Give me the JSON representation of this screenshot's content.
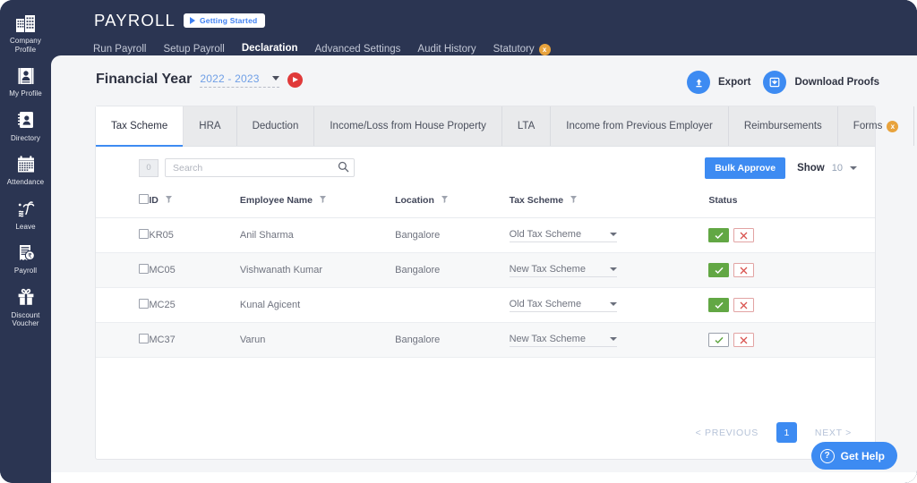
{
  "sidebar": {
    "items": [
      {
        "label": "Company Profile",
        "icon": "building-icon"
      },
      {
        "label": "My Profile",
        "icon": "id-card-icon"
      },
      {
        "label": "Directory",
        "icon": "address-book-icon"
      },
      {
        "label": "Attendance",
        "icon": "calendar-icon"
      },
      {
        "label": "Leave",
        "icon": "palm-tree-icon"
      },
      {
        "label": "Payroll",
        "icon": "payslip-rupee-icon"
      },
      {
        "label": "Discount Voucher",
        "icon": "gift-icon"
      }
    ]
  },
  "header": {
    "brand": "PAYROLL",
    "getting_started": "Getting Started",
    "nav": [
      {
        "label": "Run Payroll",
        "active": false,
        "badge": ""
      },
      {
        "label": "Setup Payroll",
        "active": false,
        "badge": ""
      },
      {
        "label": "Declaration",
        "active": true,
        "badge": ""
      },
      {
        "label": "Advanced Settings",
        "active": false,
        "badge": ""
      },
      {
        "label": "Audit History",
        "active": false,
        "badge": ""
      },
      {
        "label": "Statutory",
        "active": false,
        "badge": "x"
      }
    ]
  },
  "financial_year": {
    "label": "Financial Year",
    "value": "2022 - 2023"
  },
  "actions": {
    "export": "Export",
    "download_proofs": "Download Proofs"
  },
  "tabs": [
    {
      "label": "Tax Scheme",
      "active": true,
      "badge": ""
    },
    {
      "label": "HRA",
      "active": false,
      "badge": ""
    },
    {
      "label": "Deduction",
      "active": false,
      "badge": ""
    },
    {
      "label": "Income/Loss from House Property",
      "active": false,
      "badge": ""
    },
    {
      "label": "LTA",
      "active": false,
      "badge": ""
    },
    {
      "label": "Income from Previous Employer",
      "active": false,
      "badge": ""
    },
    {
      "label": "Reimbursements",
      "active": false,
      "badge": ""
    },
    {
      "label": "Forms",
      "active": false,
      "badge": "x"
    }
  ],
  "toolbar": {
    "count": "0",
    "search_placeholder": "Search",
    "search_value": "",
    "bulk_approve": "Bulk Approve",
    "show_label": "Show",
    "show_value": "10"
  },
  "table": {
    "columns": [
      {
        "label": "",
        "filter": false
      },
      {
        "label": "ID",
        "filter": true
      },
      {
        "label": "Employee Name",
        "filter": true
      },
      {
        "label": "Location",
        "filter": true
      },
      {
        "label": "Tax Scheme",
        "filter": true
      },
      {
        "label": "Status",
        "filter": false
      }
    ],
    "rows": [
      {
        "id": "KR05",
        "name": "Anil Sharma",
        "location": "Bangalore",
        "scheme": "Old Tax Scheme",
        "approve_style": "solid"
      },
      {
        "id": "MC05",
        "name": "Vishwanath Kumar",
        "location": "Bangalore",
        "scheme": "New Tax Scheme",
        "approve_style": "solid"
      },
      {
        "id": "MC25",
        "name": "Kunal Agicent",
        "location": "",
        "scheme": "Old Tax Scheme",
        "approve_style": "solid"
      },
      {
        "id": "MC37",
        "name": "Varun",
        "location": "Bangalore",
        "scheme": "New Tax Scheme",
        "approve_style": "outline"
      }
    ]
  },
  "pagination": {
    "previous": "< PREVIOUS",
    "current": "1",
    "next": "NEXT >"
  },
  "help": {
    "label": "Get Help",
    "icon": "question-mark-icon"
  },
  "colors": {
    "sidebar_bg": "#2b3552",
    "accent_blue": "#3d8bf2",
    "approve_green": "#62a744",
    "reject_red": "#e2a3a3",
    "badge_orange": "#e8a33d",
    "play_red": "#e03a3a",
    "panel_bg": "#f4f5f7"
  }
}
